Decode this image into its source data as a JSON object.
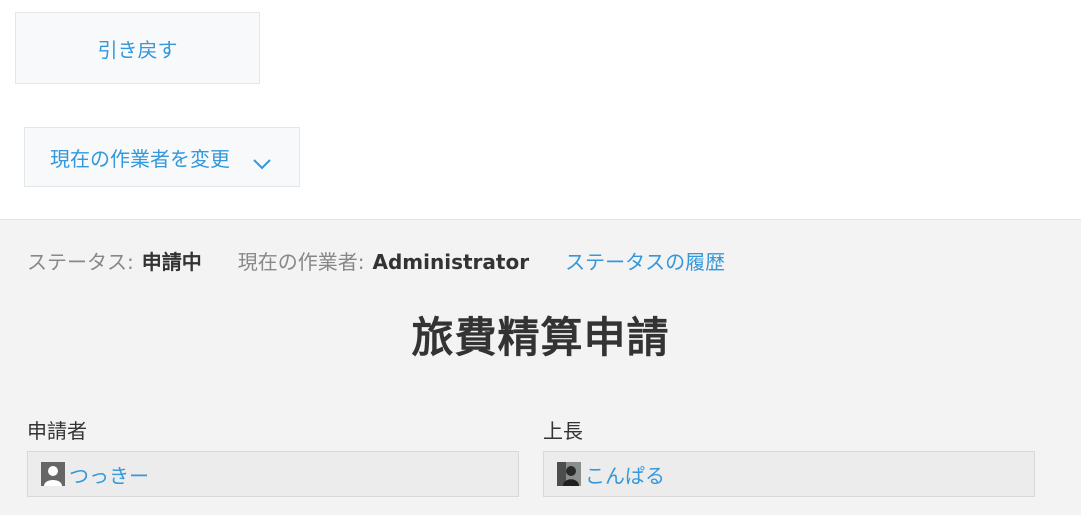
{
  "actions": {
    "revert_label": "引き戻す",
    "change_assignee_label": "現在の作業者を変更"
  },
  "status_bar": {
    "status_label": "ステータス:",
    "status_value": "申請中",
    "assignee_label": "現在の作業者:",
    "assignee_value": "Administrator",
    "history_link": "ステータスの履歴"
  },
  "form": {
    "title": "旅費精算申請",
    "fields": [
      {
        "label": "申請者",
        "user": "つっきー"
      },
      {
        "label": "上長",
        "user": "こんぱる"
      }
    ]
  },
  "colors": {
    "link": "#3498db",
    "panel_bg": "#f3f3f3"
  }
}
